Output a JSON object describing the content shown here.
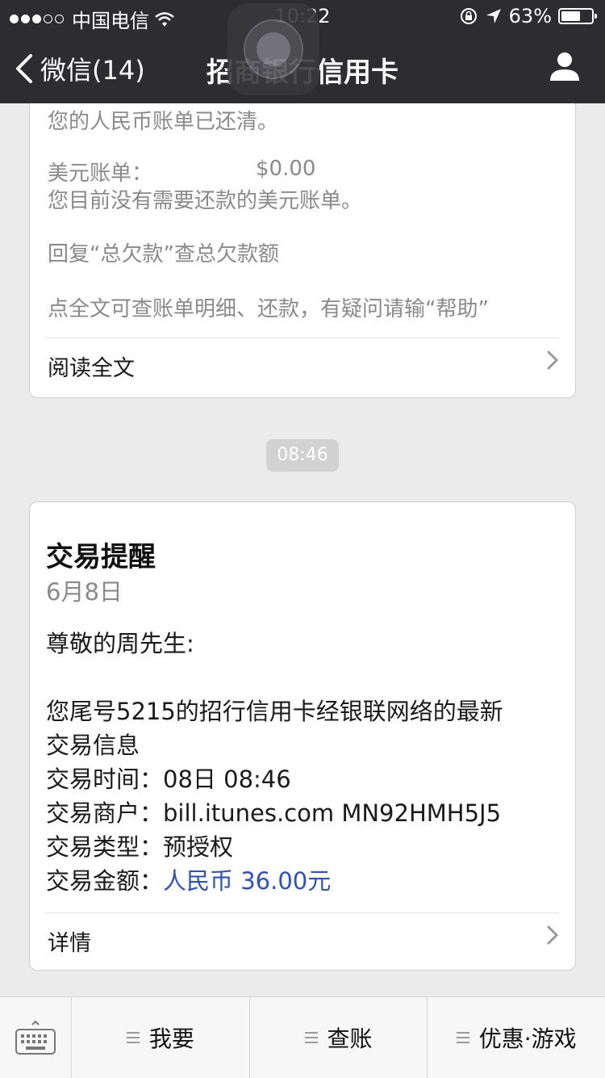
{
  "status_bar": {
    "carrier": "中国电信",
    "time": "10:22",
    "battery": "63%",
    "battery_level": 0.63
  },
  "nav": {
    "back_label": "微信(14)",
    "title": "招商银行信用卡"
  },
  "card1": {
    "lines": [
      "您的人民币账单已还清。",
      "美元账单：",
      "$0.00",
      "您目前没有需要还款的美元账单。",
      "回复“总欠款”查总欠款额",
      "点全文可查账单明细、还款，有疑问请输“帮助”"
    ],
    "read_more": "阅读全文"
  },
  "time_badge": "08:46",
  "card2": {
    "title": "交易提醒",
    "date": "6月8日",
    "greeting": "尊敬的周先生:",
    "intro_line1": "您尾号5215的招行信用卡经银联网络的最新",
    "intro_line2": "交易信息",
    "rows": [
      {
        "label": "交易时间：",
        "value": "08日 08:46"
      },
      {
        "label": "交易商户：",
        "value": "bill.itunes.com MN92HMH5J5"
      },
      {
        "label": "交易类型：",
        "value": "预授权"
      },
      {
        "label": "交易金额：",
        "value": "人民币 36.00元"
      }
    ],
    "details": "详情"
  },
  "bottom_menu": [
    "我要",
    "查账",
    "优惠·游戏"
  ],
  "colors": {
    "navbar_bg": "#2d2d30",
    "page_bg": "#ebebeb",
    "amount_blue": "#2f4fc4"
  }
}
